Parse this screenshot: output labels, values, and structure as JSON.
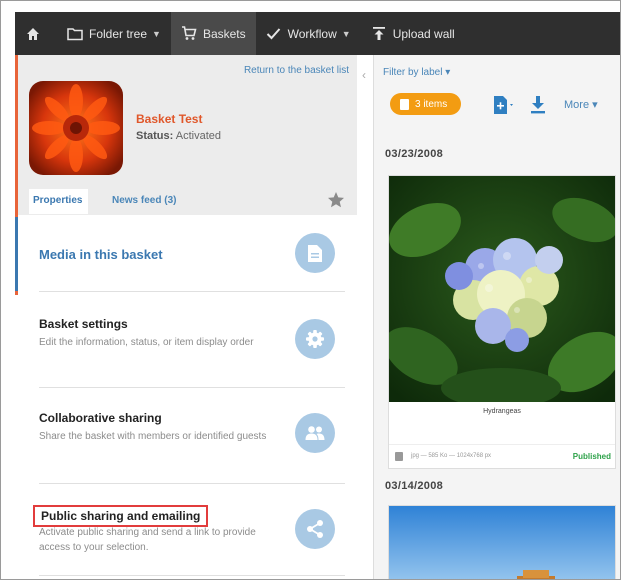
{
  "nav": {
    "items": [
      {
        "label": "",
        "icon": "home-icon"
      },
      {
        "label": "Folder tree",
        "icon": "folder-icon",
        "caret": true
      },
      {
        "label": "Baskets",
        "icon": "cart-icon",
        "active": true
      },
      {
        "label": "Workflow",
        "icon": "check-icon",
        "caret": true
      },
      {
        "label": "Upload wall",
        "icon": "upload-icon"
      }
    ]
  },
  "basket": {
    "back_link": "Return to the basket list",
    "title": "Basket Test",
    "status_label": "Status:",
    "status_value": "Activated",
    "tabs": {
      "properties": "Properties",
      "news_feed": "News feed (3)"
    }
  },
  "properties": {
    "media": {
      "title": "Media in this basket"
    },
    "settings": {
      "title": "Basket settings",
      "desc": "Edit the information, status, or item display order"
    },
    "collab": {
      "title": "Collaborative sharing",
      "desc": "Share the basket with members or identified guests"
    },
    "public": {
      "title": "Public sharing and emailing",
      "desc": "Activate public sharing and send a link to provide access to your selection."
    }
  },
  "right": {
    "filter": "Filter by label ▾",
    "items_badge": "3 items",
    "more": "More ▾",
    "groups": [
      {
        "date": "03/23/2008",
        "caption": "Hydrangeas",
        "meta": "jpg — 585 Ko — 1024x768 px",
        "status": "Published"
      },
      {
        "date": "03/14/2008"
      }
    ]
  },
  "colors": {
    "accent_orange": "#e8643a",
    "link_blue": "#4a86b8",
    "badge_orange": "#f39c12",
    "published_green": "#2ea24a",
    "highlight_red": "#e23c3c"
  }
}
